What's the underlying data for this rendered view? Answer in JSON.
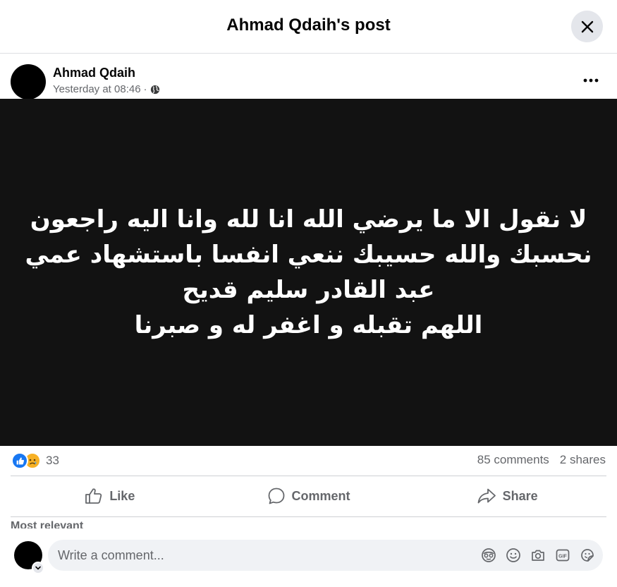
{
  "header": {
    "title": "Ahmad Qdaih's post"
  },
  "post": {
    "author": "Ahmad Qdaih",
    "timestamp": "Yesterday at 08:46",
    "separator": "·",
    "privacy_icon": "globe-icon",
    "image_text_lines": [
      "لا نقول الا ما يرضي الله انا لله وانا اليه راجعون",
      "نحسبك والله حسيبك ننعي انفسا باستشهاد عمي",
      "عبد القادر سليم قديح",
      "اللهم تقبله و اغفر له و صبرنا"
    ]
  },
  "stats": {
    "reaction_icons": [
      "like-reaction-icon",
      "sad-reaction-icon"
    ],
    "reaction_count": "33",
    "comments": "85 comments",
    "shares": "2 shares"
  },
  "actions": {
    "like": "Like",
    "comment": "Comment",
    "share": "Share"
  },
  "comments_section": {
    "sort_label": "Most relevant"
  },
  "composer": {
    "placeholder": "Write a comment...",
    "tools": [
      "avatar-sticker-icon",
      "emoji-icon",
      "camera-icon",
      "gif-icon",
      "sticker-icon"
    ]
  },
  "colors": {
    "background": "#ffffff",
    "image_background": "#121212",
    "secondary_text": "#65676b",
    "like_blue": "#1877f2",
    "input_background": "#f0f2f5"
  }
}
